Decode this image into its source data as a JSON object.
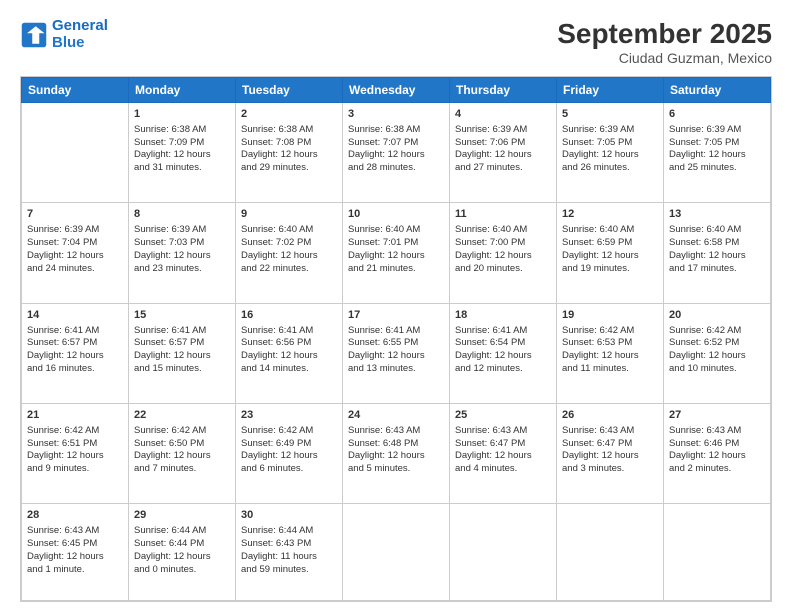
{
  "header": {
    "logo_line1": "General",
    "logo_line2": "Blue",
    "month": "September 2025",
    "location": "Ciudad Guzman, Mexico"
  },
  "days_of_week": [
    "Sunday",
    "Monday",
    "Tuesday",
    "Wednesday",
    "Thursday",
    "Friday",
    "Saturday"
  ],
  "weeks": [
    [
      {
        "num": "",
        "lines": []
      },
      {
        "num": "1",
        "lines": [
          "Sunrise: 6:38 AM",
          "Sunset: 7:09 PM",
          "Daylight: 12 hours",
          "and 31 minutes."
        ]
      },
      {
        "num": "2",
        "lines": [
          "Sunrise: 6:38 AM",
          "Sunset: 7:08 PM",
          "Daylight: 12 hours",
          "and 29 minutes."
        ]
      },
      {
        "num": "3",
        "lines": [
          "Sunrise: 6:38 AM",
          "Sunset: 7:07 PM",
          "Daylight: 12 hours",
          "and 28 minutes."
        ]
      },
      {
        "num": "4",
        "lines": [
          "Sunrise: 6:39 AM",
          "Sunset: 7:06 PM",
          "Daylight: 12 hours",
          "and 27 minutes."
        ]
      },
      {
        "num": "5",
        "lines": [
          "Sunrise: 6:39 AM",
          "Sunset: 7:05 PM",
          "Daylight: 12 hours",
          "and 26 minutes."
        ]
      },
      {
        "num": "6",
        "lines": [
          "Sunrise: 6:39 AM",
          "Sunset: 7:05 PM",
          "Daylight: 12 hours",
          "and 25 minutes."
        ]
      }
    ],
    [
      {
        "num": "7",
        "lines": [
          "Sunrise: 6:39 AM",
          "Sunset: 7:04 PM",
          "Daylight: 12 hours",
          "and 24 minutes."
        ]
      },
      {
        "num": "8",
        "lines": [
          "Sunrise: 6:39 AM",
          "Sunset: 7:03 PM",
          "Daylight: 12 hours",
          "and 23 minutes."
        ]
      },
      {
        "num": "9",
        "lines": [
          "Sunrise: 6:40 AM",
          "Sunset: 7:02 PM",
          "Daylight: 12 hours",
          "and 22 minutes."
        ]
      },
      {
        "num": "10",
        "lines": [
          "Sunrise: 6:40 AM",
          "Sunset: 7:01 PM",
          "Daylight: 12 hours",
          "and 21 minutes."
        ]
      },
      {
        "num": "11",
        "lines": [
          "Sunrise: 6:40 AM",
          "Sunset: 7:00 PM",
          "Daylight: 12 hours",
          "and 20 minutes."
        ]
      },
      {
        "num": "12",
        "lines": [
          "Sunrise: 6:40 AM",
          "Sunset: 6:59 PM",
          "Daylight: 12 hours",
          "and 19 minutes."
        ]
      },
      {
        "num": "13",
        "lines": [
          "Sunrise: 6:40 AM",
          "Sunset: 6:58 PM",
          "Daylight: 12 hours",
          "and 17 minutes."
        ]
      }
    ],
    [
      {
        "num": "14",
        "lines": [
          "Sunrise: 6:41 AM",
          "Sunset: 6:57 PM",
          "Daylight: 12 hours",
          "and 16 minutes."
        ]
      },
      {
        "num": "15",
        "lines": [
          "Sunrise: 6:41 AM",
          "Sunset: 6:57 PM",
          "Daylight: 12 hours",
          "and 15 minutes."
        ]
      },
      {
        "num": "16",
        "lines": [
          "Sunrise: 6:41 AM",
          "Sunset: 6:56 PM",
          "Daylight: 12 hours",
          "and 14 minutes."
        ]
      },
      {
        "num": "17",
        "lines": [
          "Sunrise: 6:41 AM",
          "Sunset: 6:55 PM",
          "Daylight: 12 hours",
          "and 13 minutes."
        ]
      },
      {
        "num": "18",
        "lines": [
          "Sunrise: 6:41 AM",
          "Sunset: 6:54 PM",
          "Daylight: 12 hours",
          "and 12 minutes."
        ]
      },
      {
        "num": "19",
        "lines": [
          "Sunrise: 6:42 AM",
          "Sunset: 6:53 PM",
          "Daylight: 12 hours",
          "and 11 minutes."
        ]
      },
      {
        "num": "20",
        "lines": [
          "Sunrise: 6:42 AM",
          "Sunset: 6:52 PM",
          "Daylight: 12 hours",
          "and 10 minutes."
        ]
      }
    ],
    [
      {
        "num": "21",
        "lines": [
          "Sunrise: 6:42 AM",
          "Sunset: 6:51 PM",
          "Daylight: 12 hours",
          "and 9 minutes."
        ]
      },
      {
        "num": "22",
        "lines": [
          "Sunrise: 6:42 AM",
          "Sunset: 6:50 PM",
          "Daylight: 12 hours",
          "and 7 minutes."
        ]
      },
      {
        "num": "23",
        "lines": [
          "Sunrise: 6:42 AM",
          "Sunset: 6:49 PM",
          "Daylight: 12 hours",
          "and 6 minutes."
        ]
      },
      {
        "num": "24",
        "lines": [
          "Sunrise: 6:43 AM",
          "Sunset: 6:48 PM",
          "Daylight: 12 hours",
          "and 5 minutes."
        ]
      },
      {
        "num": "25",
        "lines": [
          "Sunrise: 6:43 AM",
          "Sunset: 6:47 PM",
          "Daylight: 12 hours",
          "and 4 minutes."
        ]
      },
      {
        "num": "26",
        "lines": [
          "Sunrise: 6:43 AM",
          "Sunset: 6:47 PM",
          "Daylight: 12 hours",
          "and 3 minutes."
        ]
      },
      {
        "num": "27",
        "lines": [
          "Sunrise: 6:43 AM",
          "Sunset: 6:46 PM",
          "Daylight: 12 hours",
          "and 2 minutes."
        ]
      }
    ],
    [
      {
        "num": "28",
        "lines": [
          "Sunrise: 6:43 AM",
          "Sunset: 6:45 PM",
          "Daylight: 12 hours",
          "and 1 minute."
        ]
      },
      {
        "num": "29",
        "lines": [
          "Sunrise: 6:44 AM",
          "Sunset: 6:44 PM",
          "Daylight: 12 hours",
          "and 0 minutes."
        ]
      },
      {
        "num": "30",
        "lines": [
          "Sunrise: 6:44 AM",
          "Sunset: 6:43 PM",
          "Daylight: 11 hours",
          "and 59 minutes."
        ]
      },
      {
        "num": "",
        "lines": []
      },
      {
        "num": "",
        "lines": []
      },
      {
        "num": "",
        "lines": []
      },
      {
        "num": "",
        "lines": []
      }
    ]
  ]
}
